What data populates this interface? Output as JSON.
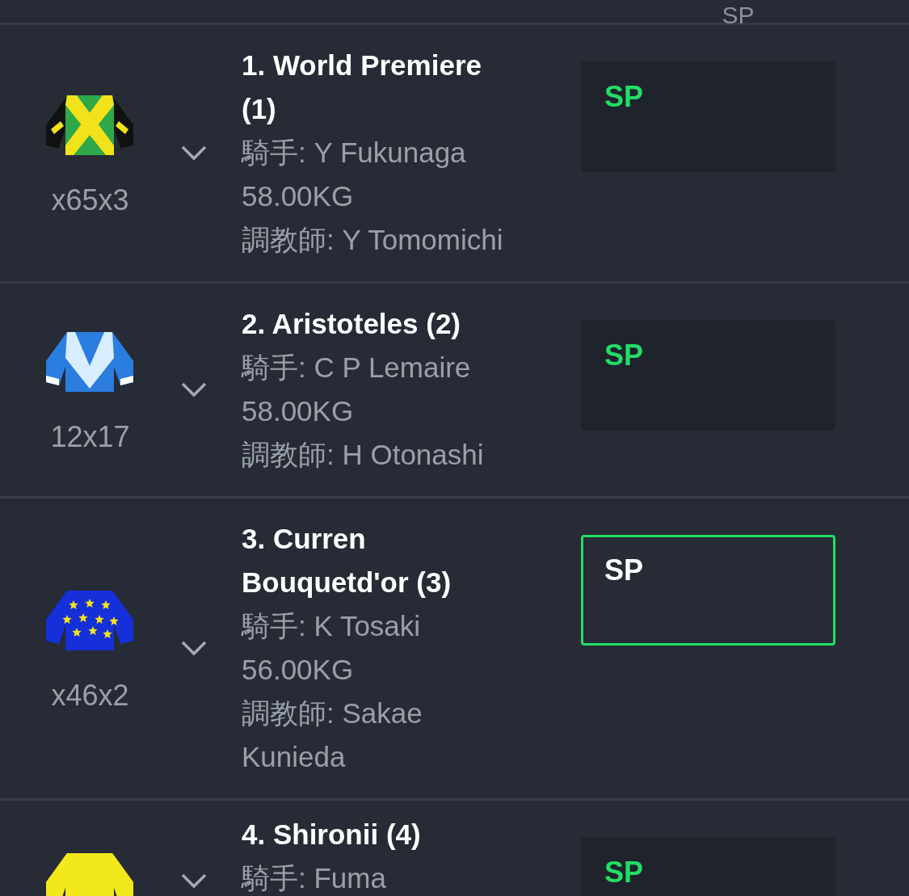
{
  "header": {
    "odds_column": "SP"
  },
  "runners": [
    {
      "name": "1. World Premiere (1)",
      "number": "x65x3",
      "jockey": "騎手: Y Fukunaga",
      "weight": "58.00KG",
      "trainer": "調教師: Y Tomomichi",
      "expanded": false,
      "odds": {
        "label": "SP",
        "selected": false
      }
    },
    {
      "name": "2. Aristoteles (2)",
      "number": "12x17",
      "jockey": "騎手: C P Lemaire",
      "weight": "58.00KG",
      "trainer": "調教師: H Otonashi",
      "expanded": false,
      "odds": {
        "label": "SP",
        "selected": false
      }
    },
    {
      "name": "3. Curren Bouquetd'or (3)",
      "number": "x46x2",
      "jockey": "騎手: K Tosaki",
      "weight": "56.00KG",
      "trainer": "調教師: Sakae Kunieda",
      "expanded": false,
      "odds": {
        "label": "SP",
        "selected": true
      }
    },
    {
      "name": "4. Shironii (4)",
      "jockey": "騎手: Fuma",
      "expanded": false,
      "odds": {
        "label": "SP",
        "selected": false
      }
    }
  ]
}
